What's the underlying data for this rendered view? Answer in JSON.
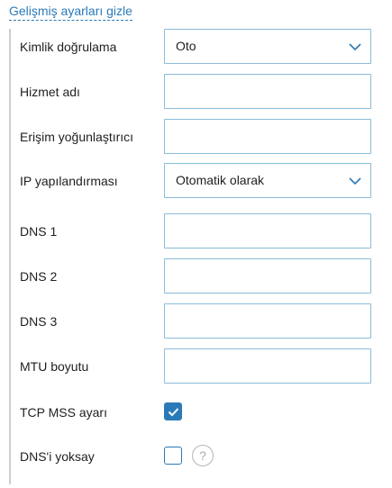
{
  "toggle_link": "Gelişmiş ayarları gizle",
  "fields": {
    "auth": {
      "label": "Kimlik doğrulama",
      "value": "Oto"
    },
    "service_name": {
      "label": "Hizmet adı",
      "value": ""
    },
    "access_concentrator": {
      "label": "Erişim yoğunlaştırıcı",
      "value": ""
    },
    "ip_config": {
      "label": "IP yapılandırması",
      "value": "Otomatik olarak"
    },
    "dns1": {
      "label": "DNS 1",
      "value": ""
    },
    "dns2": {
      "label": "DNS 2",
      "value": ""
    },
    "dns3": {
      "label": "DNS 3",
      "value": ""
    },
    "mtu": {
      "label": "MTU boyutu",
      "value": ""
    },
    "tcp_mss": {
      "label": "TCP MSS ayarı",
      "checked": true
    },
    "ignore_dns": {
      "label": "DNS'i yoksay",
      "checked": false,
      "help": "?"
    }
  },
  "colors": {
    "accent": "#2a7ab8",
    "field_border": "#8bbcd9",
    "divider": "#cfcfcf"
  },
  "icons": {
    "select_arrow": "chevron-down-icon",
    "check": "check-icon",
    "help": "question-circle-icon"
  }
}
